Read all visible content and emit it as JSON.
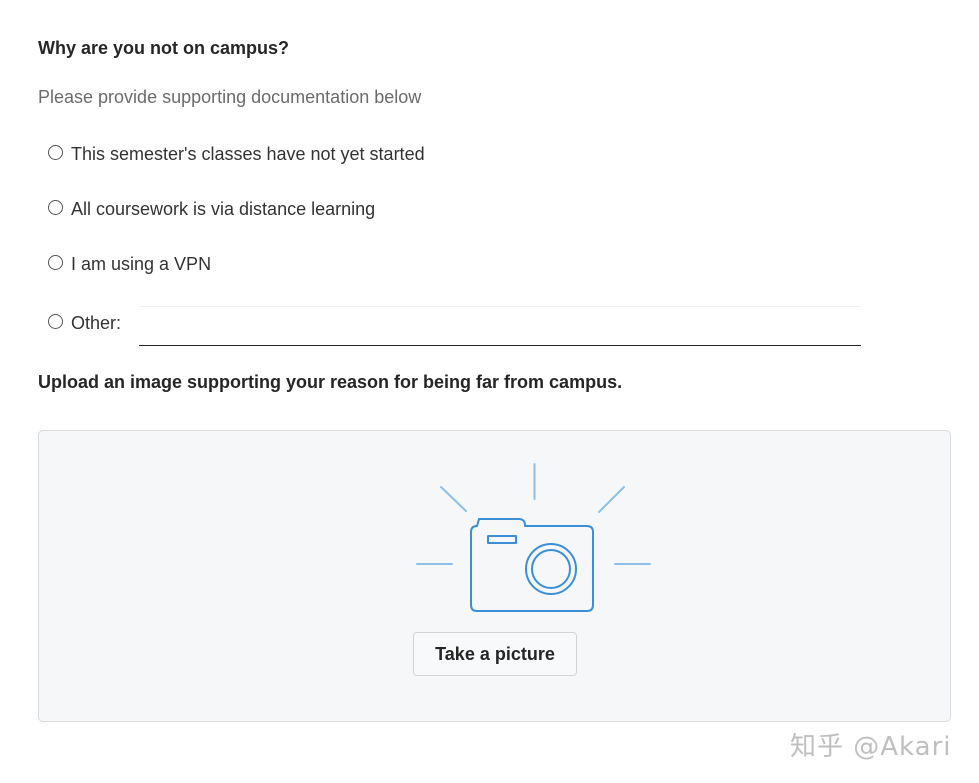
{
  "question": {
    "title": "Why are you not on campus?",
    "subtitle": "Please provide supporting documentation below",
    "options": [
      {
        "label": "This semester's classes have not yet started",
        "selected": false
      },
      {
        "label": "All coursework is via distance learning",
        "selected": false
      },
      {
        "label": "I am using a VPN",
        "selected": false
      },
      {
        "label": "Other:",
        "selected": false
      }
    ],
    "other_value": "",
    "other_placeholder": ""
  },
  "upload": {
    "title": "Upload an image supporting your reason for being far from campus.",
    "icon": "camera-icon",
    "button_label": "Take a picture",
    "accent_color": "#3b8fd6"
  },
  "watermark": "知乎 @Akari"
}
